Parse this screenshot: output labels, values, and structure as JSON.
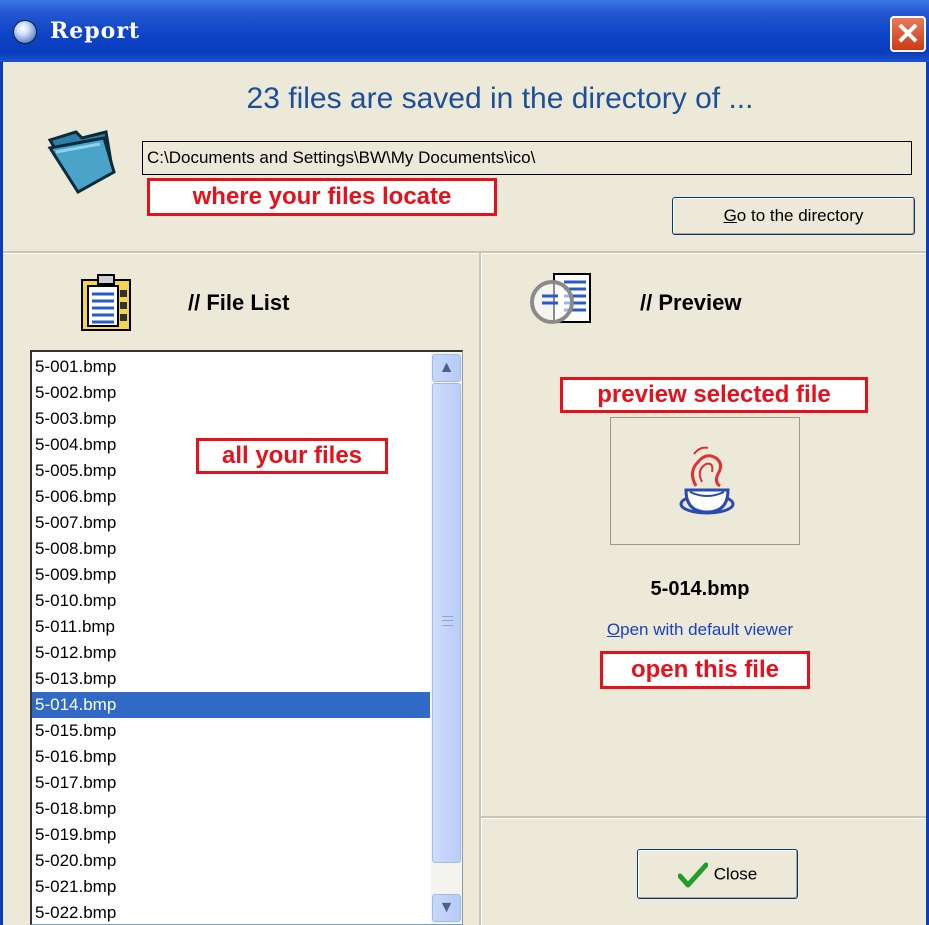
{
  "window": {
    "title": "Report"
  },
  "header": {
    "headline": "23 files are saved in the directory of ...",
    "path": "C:\\Documents and Settings\\BW\\My Documents\\ico\\",
    "go_button": "Go to the directory",
    "go_button_access": "G",
    "go_button_rest": "o to the directory"
  },
  "annotations": {
    "path_note": "where your files locate",
    "list_note": "all your files",
    "preview_note": "preview selected file",
    "open_note": "open this file"
  },
  "file_list": {
    "title": "// File List",
    "items": [
      "5-001.bmp",
      "5-002.bmp",
      "5-003.bmp",
      "5-004.bmp",
      "5-005.bmp",
      "5-006.bmp",
      "5-007.bmp",
      "5-008.bmp",
      "5-009.bmp",
      "5-010.bmp",
      "5-011.bmp",
      "5-012.bmp",
      "5-013.bmp",
      "5-014.bmp",
      "5-015.bmp",
      "5-016.bmp",
      "5-017.bmp",
      "5-018.bmp",
      "5-019.bmp",
      "5-020.bmp",
      "5-021.bmp",
      "5-022.bmp"
    ],
    "selected_index": 13
  },
  "preview": {
    "title": "// Preview",
    "filename": "5-014.bmp",
    "open_link": "Open with default viewer",
    "open_link_access": "O",
    "open_link_rest": "pen with default viewer"
  },
  "footer": {
    "close_button": "Close"
  },
  "colors": {
    "accent": "#1b4f9c",
    "annotation": "#e8101a",
    "selection": "#316ac5",
    "titlebar": "#0a3dbd"
  }
}
